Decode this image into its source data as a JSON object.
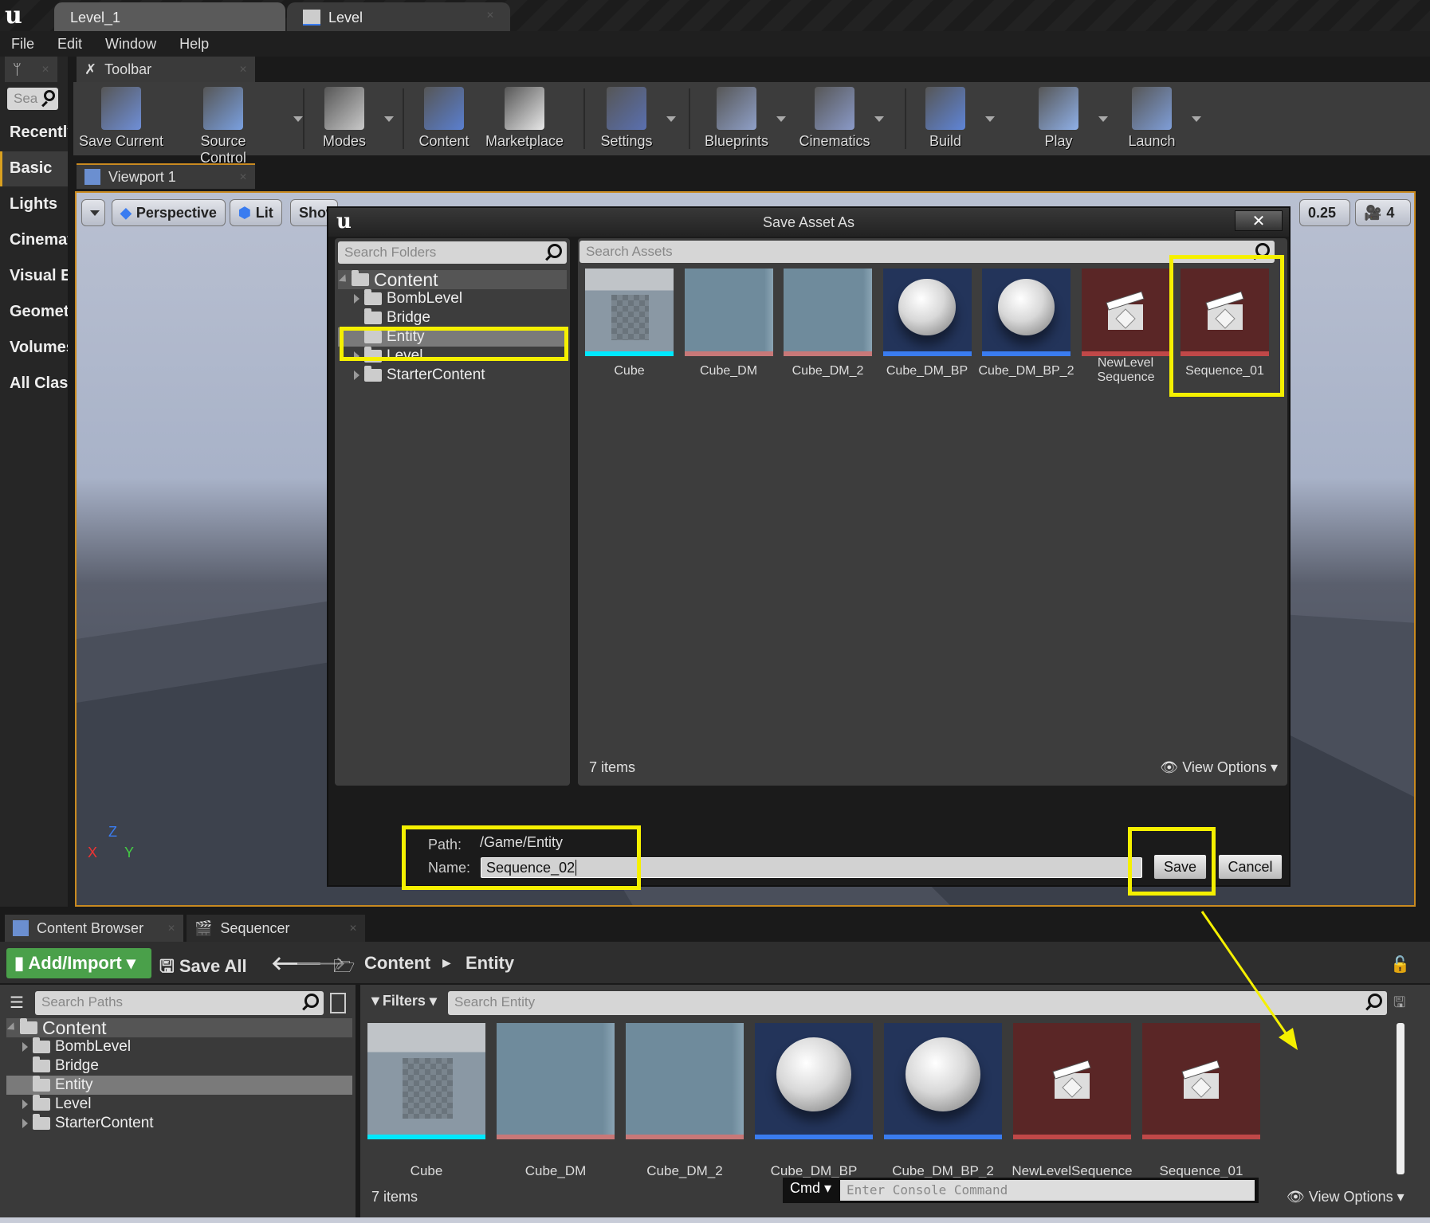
{
  "window": {
    "doc_tabs": [
      {
        "label": "Level_1"
      },
      {
        "label": "Level"
      }
    ],
    "menu": [
      "File",
      "Edit",
      "Window",
      "Help"
    ]
  },
  "modes_panel": {
    "search_placeholder": "Sea",
    "items": [
      "Recently",
      "Basic",
      "Lights",
      "Cinemat",
      "Visual E",
      "Geometr",
      "Volumes",
      "All Clas"
    ],
    "selected": "Basic"
  },
  "toolbar": {
    "tab_label": "Toolbar",
    "items": [
      {
        "label": "Save Current",
        "icon": "floppy-disk-icon",
        "color": "#6f8fd8"
      },
      {
        "label": "Source Control",
        "icon": "source-control-icon",
        "color": "#7aa0e0"
      },
      {
        "label": "Modes",
        "icon": "modes-icon",
        "color": "#c9c9c9"
      },
      {
        "label": "Content",
        "icon": "content-grid-icon",
        "color": "#5a7fd0"
      },
      {
        "label": "Marketplace",
        "icon": "marketplace-bag-icon",
        "color": "#e8e8e8"
      },
      {
        "label": "Settings",
        "icon": "gear-icon",
        "color": "#5a70b0"
      },
      {
        "label": "Blueprints",
        "icon": "blueprints-icon",
        "color": "#8fa0c8"
      },
      {
        "label": "Cinematics",
        "icon": "clapperboard-icon",
        "color": "#8a9ac8"
      },
      {
        "label": "Build",
        "icon": "build-cubes-icon",
        "color": "#5f85d8"
      },
      {
        "label": "Play",
        "icon": "play-icon",
        "color": "#8fb0e8"
      },
      {
        "label": "Launch",
        "icon": "launch-monitor-icon",
        "color": "#7f9ed8"
      }
    ]
  },
  "viewport": {
    "tab_label": "Viewport 1",
    "perspective": "Perspective",
    "lit": "Lit",
    "show": "Show",
    "grid_snap": "0.25",
    "camera_speed": "4",
    "axes": {
      "x": "X",
      "y": "Y",
      "z": "Z"
    }
  },
  "dialog": {
    "title": "Save Asset As",
    "close": "✕",
    "search_folders_placeholder": "Search Folders",
    "search_assets_placeholder": "Search Assets",
    "folders": [
      {
        "label": "Content",
        "level": 0,
        "expanded": true
      },
      {
        "label": "BombLevel",
        "level": 1,
        "expandable": true
      },
      {
        "label": "Bridge",
        "level": 1
      },
      {
        "label": "Entity",
        "level": 1,
        "selected": true
      },
      {
        "label": "Level",
        "level": 1,
        "expandable": true
      },
      {
        "label": "StarterContent",
        "level": 1,
        "expandable": true
      }
    ],
    "item_count": "7 items",
    "view_options": "View Options",
    "path_label": "Path:",
    "path_value": "/Game/Entity",
    "name_label": "Name:",
    "name_value": "Sequence_02",
    "save": "Save",
    "cancel": "Cancel"
  },
  "assets": [
    {
      "label": "Cube",
      "type": "static-mesh",
      "bar": "#00e8ff"
    },
    {
      "label": "Cube_DM",
      "type": "destructible",
      "bar": "#c87878"
    },
    {
      "label": "Cube_DM_2",
      "type": "destructible",
      "bar": "#c87878"
    },
    {
      "label": "Cube_DM_BP",
      "type": "material",
      "bar": "#3a7cf0"
    },
    {
      "label": "Cube_DM_BP_2",
      "type": "material",
      "bar": "#3a7cf0"
    },
    {
      "label": "NewLevelSequence",
      "dialog_label": "NewLevel Sequence",
      "type": "level-sequence",
      "bar": "#c04848"
    },
    {
      "label": "Sequence_01",
      "type": "level-sequence",
      "bar": "#c04848"
    }
  ],
  "content_browser": {
    "tabs": [
      {
        "label": "Content Browser"
      },
      {
        "label": "Sequencer"
      }
    ],
    "add_import": "Add/Import",
    "save_all": "Save All",
    "breadcrumb": [
      "Content",
      "Entity"
    ],
    "search_paths_placeholder": "Search Paths",
    "filters": "Filters",
    "search_placeholder": "Search Entity",
    "folders": [
      {
        "label": "Content"
      },
      {
        "label": "BombLevel"
      },
      {
        "label": "Bridge"
      },
      {
        "label": "Entity",
        "selected": true
      },
      {
        "label": "Level"
      },
      {
        "label": "StarterContent"
      }
    ],
    "item_count": "7 items",
    "view_options": "View Options",
    "console_mode": "Cmd",
    "console_placeholder": "Enter Console Command"
  },
  "colors": {
    "highlight": "#f5f000",
    "accent": "#c98a20",
    "add_import": "#4aa04a"
  }
}
